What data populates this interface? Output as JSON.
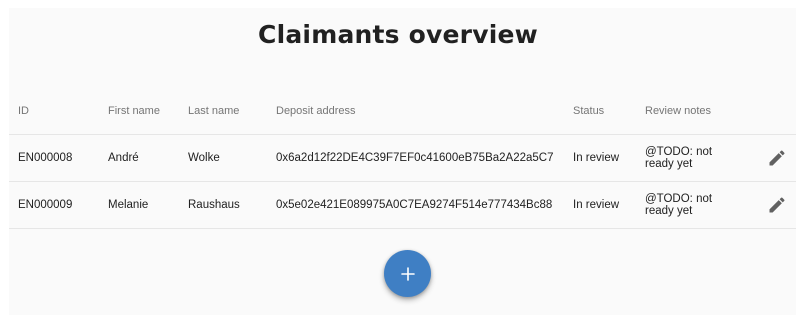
{
  "page": {
    "title": "Claimants overview"
  },
  "table": {
    "columns": {
      "id": "ID",
      "first_name": "First name",
      "last_name": "Last name",
      "deposit_address": "Deposit address",
      "status": "Status",
      "review_notes": "Review notes"
    },
    "rows": [
      {
        "id": "EN000008",
        "first_name": "André",
        "last_name": "Wolke",
        "deposit_address": "0x6a2d12f22DE4C39F7EF0c41600eB75Ba2A22a5C7",
        "status": "In review",
        "review_notes": "@TODO: not ready yet",
        "edit_icon": "pencil-icon"
      },
      {
        "id": "EN000009",
        "first_name": "Melanie",
        "last_name": "Raushaus",
        "deposit_address": "0x5e02e421E089975A0C7EA9274F514e777434Bc88",
        "status": "In review",
        "review_notes": "@TODO: not ready yet",
        "edit_icon": "pencil-icon"
      }
    ]
  },
  "fab": {
    "icon": "plus-icon",
    "label": "+"
  },
  "colors": {
    "accent": "#3f7fc4",
    "icon": "#616161",
    "background": "#fafafa"
  }
}
